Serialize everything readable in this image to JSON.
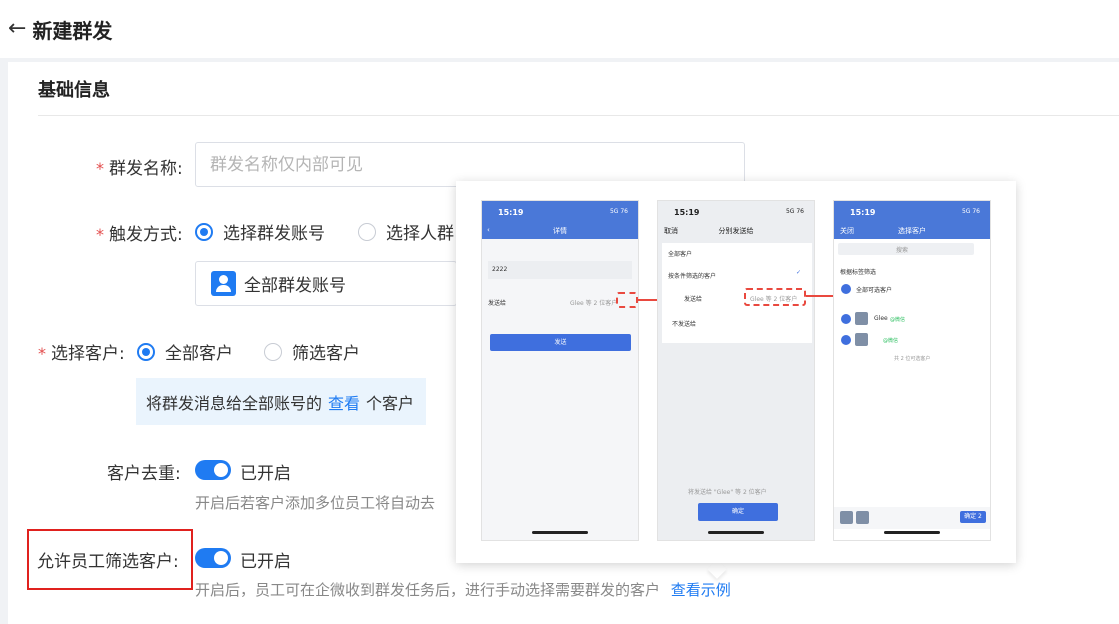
{
  "header": {
    "back_icon": "arrow-left-icon",
    "title": "新建群发"
  },
  "section": {
    "title": "基础信息"
  },
  "form": {
    "name": {
      "label": "群发名称:",
      "placeholder": "群发名称仅内部可见",
      "value": ""
    },
    "trigger": {
      "label": "触发方式:",
      "options": [
        "选择群发账号",
        "选择人群"
      ],
      "selected": "选择群发账号",
      "account_box": "全部群发账号",
      "account_icon": "user-icon"
    },
    "customers": {
      "label": "选择客户:",
      "options": [
        "全部客户",
        "筛选客户"
      ],
      "selected": "全部客户",
      "info": {
        "prefix": "将群发消息给全部账号的",
        "link": "查看",
        "suffix": "个客户"
      }
    },
    "dedupe": {
      "label": "客户去重:",
      "enabled": true,
      "state": "已开启",
      "hint": "开启后若客户添加多位员工将自动去"
    },
    "allow_filter": {
      "label": "允许员工筛选客户:",
      "enabled": true,
      "state": "已开启",
      "hint": "开启后，员工可在企微收到群发任务后，进行手动选择需要群发的客户",
      "link": "查看示例"
    }
  },
  "example_popover": {
    "phone1": {
      "time": "15:19",
      "status": "5G 76",
      "title": "详情",
      "field_value": "2222",
      "row_label": "发送给",
      "row_value": "Glee 等 2 位客户",
      "button": "发送"
    },
    "phone2": {
      "time": "15:19",
      "status": "5G 76",
      "cancel": "取消",
      "title": "分别发送给",
      "all_label": "全部客户",
      "by_filter": "按条件筛选的客户",
      "send_to": "发送给",
      "send_value": "Glee 等 2 位客户",
      "not_send": "不发送给",
      "footer_note": "将发送给 \"Glee\" 等 2 位客户",
      "confirm": "确定"
    },
    "phone3": {
      "time": "15:19",
      "status": "5G 76",
      "close": "关闭",
      "title": "选择客户",
      "search": "搜索",
      "filter_label": "根据标签筛选",
      "select_all": "全部可选客户",
      "customer1": "Glee",
      "tag1": "@微信",
      "tag2": "@微信",
      "footer_note": "共 2 位可选客户",
      "confirm": "确定 2"
    }
  },
  "colors": {
    "accent": "#1f7bf2",
    "required": "#e34d4d",
    "highlight_box": "#e0211e",
    "info_bg": "#eaf4fd"
  }
}
